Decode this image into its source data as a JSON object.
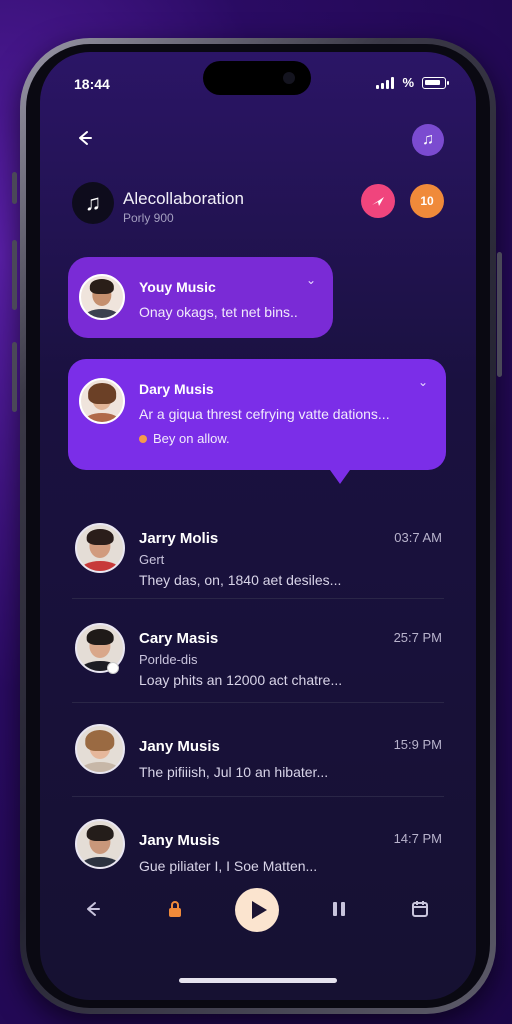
{
  "status": {
    "time": "18:44",
    "network": "%"
  },
  "header": {
    "title": "Alecollaboration",
    "subtitle": "Porly 900",
    "action_label_2": "10"
  },
  "highlights": [
    {
      "name": "Youy Music",
      "text": "Onay okags, tet net bins.."
    },
    {
      "name": "Dary Musis",
      "text": "Ar a giqua threst cefrying vatte dations...",
      "extra": "Bey on allow."
    }
  ],
  "chats": [
    {
      "name": "Jarry Molis",
      "sub": "Gert",
      "preview": "They das, on, 1840 aet desiles...",
      "time": "03:7 AM"
    },
    {
      "name": "Cary Masis",
      "sub": "Porlde-dis",
      "preview": "Loay phits an 12000 act chatre...",
      "time": "25:7 PM"
    },
    {
      "name": "Jany Musis",
      "sub": "",
      "preview": "The pifiiish, Jul 10 an hibater...",
      "time": "15:9 PM"
    },
    {
      "name": "Jany Musis",
      "sub": "",
      "preview": "Gue piliater I, I Soe Matten...",
      "time": "14:7 PM"
    }
  ],
  "icons": {
    "back": "arrow-left-icon",
    "music": "music-note-icon",
    "send": "send-icon",
    "lock": "lock-icon",
    "play": "play-icon",
    "pause": "pause-icon",
    "calendar": "calendar-icon",
    "chevron": "chevron-down-icon"
  },
  "colors": {
    "accent": "#7b2ee8",
    "pink": "#f0457d",
    "orange": "#f08a3a",
    "background": "#1a1140"
  }
}
